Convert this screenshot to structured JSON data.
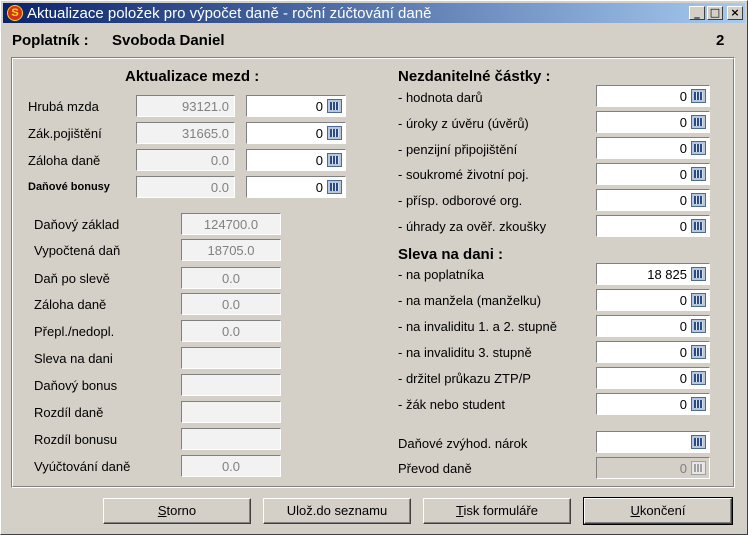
{
  "window": {
    "title": "Aktualizace položek pro výpočet daně - roční zúčtování daně",
    "icon_letter": "S",
    "min_glyph": "_",
    "max_glyph": "□",
    "close_glyph": "×"
  },
  "header": {
    "label": "Poplatník :",
    "name": "Svoboda Daniel",
    "number": "2"
  },
  "wages": {
    "heading": "Aktualizace mezd :",
    "rows": [
      {
        "label": "Hrubá mzda",
        "value": "93121.0",
        "input": "0"
      },
      {
        "label": "Zák.pojištění",
        "value": "31665.0",
        "input": "0"
      },
      {
        "label": "Záloha daně",
        "value": "0.0",
        "input": "0"
      },
      {
        "label": "Daňové bonusy",
        "value": "0.0",
        "input": "0"
      }
    ]
  },
  "results": {
    "rows": [
      {
        "label": "Daňový základ",
        "value": "124700.0"
      },
      {
        "label": "Vypočtená daň",
        "value": "18705.0"
      },
      {
        "label": "Daň po slevě",
        "value": "0.0"
      },
      {
        "label": "Záloha daně",
        "value": "0.0"
      },
      {
        "label": "Přepl./nedopl.",
        "value": "0.0"
      },
      {
        "label": "Sleva na dani",
        "value": ""
      },
      {
        "label": "Daňový bonus",
        "value": ""
      },
      {
        "label": "Rozdíl daně",
        "value": ""
      },
      {
        "label": "Rozdíl bonusu",
        "value": ""
      },
      {
        "label": "Vyúčtování daně",
        "value": "0.0"
      }
    ]
  },
  "deductions": {
    "heading": "Nezdanitelné částky :",
    "rows": [
      {
        "label": "- hodnota darů",
        "value": "0"
      },
      {
        "label": "- úroky z úvěru (úvěrů)",
        "value": "0"
      },
      {
        "label": "- penzijní připojištění",
        "value": "0"
      },
      {
        "label": "- soukromé životní poj.",
        "value": "0"
      },
      {
        "label": "- přísp. odborové org.",
        "value": "0"
      },
      {
        "label": "- úhrady za ověř. zkoušky",
        "value": "0"
      }
    ]
  },
  "discounts": {
    "heading": "Sleva na dani :",
    "rows": [
      {
        "label": "- na poplatníka",
        "value": "18 825"
      },
      {
        "label": "- na manžela (manželku)",
        "value": "0"
      },
      {
        "label": "- na invaliditu 1. a 2. stupně",
        "value": "0"
      },
      {
        "label": "- na invaliditu 3. stupně",
        "value": "0"
      },
      {
        "label": "- držitel průkazu ZTP/P",
        "value": "0"
      },
      {
        "label": "- žák nebo student",
        "value": "0"
      }
    ]
  },
  "extra": {
    "claim_label": "Daňové zvýhod. nárok",
    "claim_value": "",
    "transfer_label": "Převod daně",
    "transfer_value": "0"
  },
  "buttons": {
    "cancel": {
      "u": "S",
      "rest": "torno"
    },
    "save": {
      "u": "",
      "rest": "Ulož.do seznamu"
    },
    "print": {
      "u": "T",
      "rest": "isk formuláře"
    },
    "close": {
      "u": "U",
      "rest": "končení"
    }
  }
}
